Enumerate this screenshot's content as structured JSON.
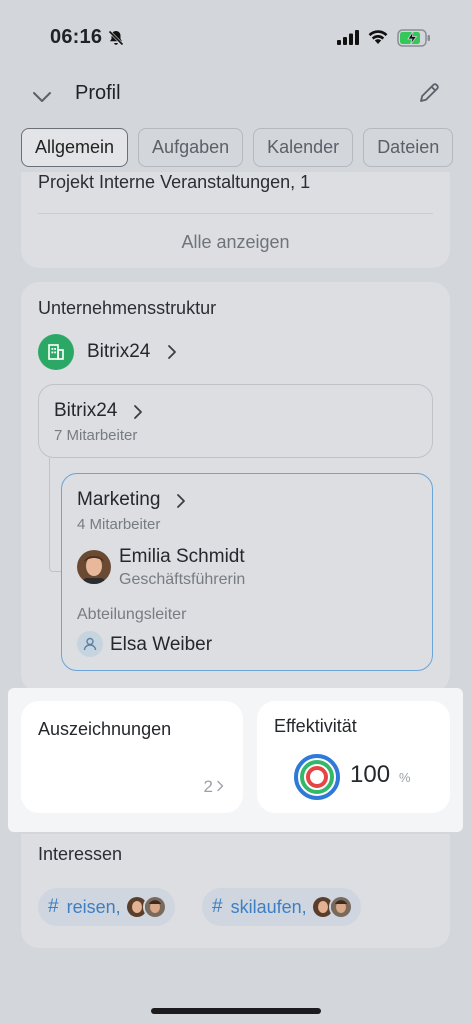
{
  "status_bar": {
    "time": "06:16"
  },
  "header": {
    "title": "Profil"
  },
  "tabs": [
    {
      "label": "Allgemein",
      "active": true
    },
    {
      "label": "Aufgaben",
      "active": false
    },
    {
      "label": "Kalender",
      "active": false
    },
    {
      "label": "Dateien",
      "active": false
    }
  ],
  "projects": {
    "last_item": "Projekt Interne Veranstaltungen, 1",
    "show_all": "Alle anzeigen"
  },
  "structure": {
    "title": "Unternehmensstruktur",
    "company": "Bitrix24",
    "top_department": {
      "name": "Bitrix24",
      "count": "7 Mitarbeiter"
    },
    "sub_department": {
      "name": "Marketing",
      "count": "4 Mitarbeiter",
      "person_name": "Emilia Schmidt",
      "person_role": "Geschäftsführerin",
      "head_label": "Abteilungsleiter",
      "head_name": "Elsa Weiber"
    }
  },
  "awards": {
    "title": "Auszeichnungen",
    "count": "2"
  },
  "effectiveness": {
    "title": "Effektivität",
    "value": "100",
    "unit": "%"
  },
  "interests": {
    "title": "Interessen",
    "tags": [
      {
        "hash": "#",
        "label": "reisen,"
      },
      {
        "hash": "#",
        "label": "skilaufen,"
      }
    ]
  },
  "colors": {
    "accent_blue": "#3d7fc4",
    "company_green": "#2ba865"
  }
}
